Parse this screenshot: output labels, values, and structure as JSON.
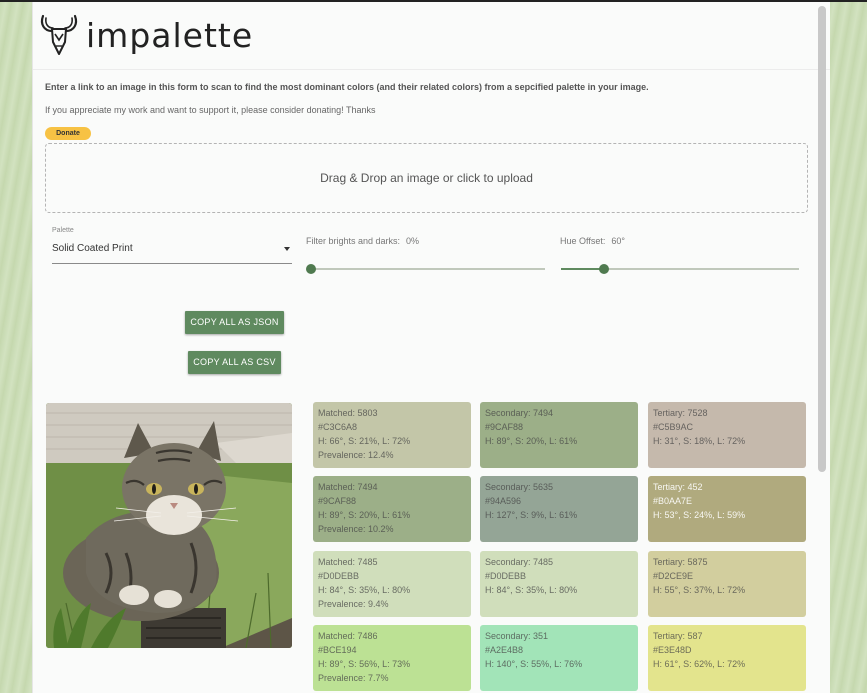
{
  "app": {
    "name": "impalette"
  },
  "intro": {
    "text": "Enter a link to an image in this form to scan to find the most dominant colors (and their related colors) from a sepcified palette in your image.",
    "support": "If you appreciate my work and want to support it, please consider donating! Thanks",
    "donate_label": "Donate"
  },
  "upload": {
    "label": "Drag & Drop an image or click to upload"
  },
  "palette": {
    "label": "Palette",
    "value": "Solid Coated Print"
  },
  "sliders": {
    "filter": {
      "label": "Filter brights and darks:",
      "value_text": "0%",
      "level": 0
    },
    "hue": {
      "label": "Hue Offset:",
      "value_text": "60°",
      "level": 0.18
    }
  },
  "buttons": {
    "copy_json": "COPY ALL AS JSON",
    "copy_csv": "COPY ALL AS CSV"
  },
  "image": {
    "subject": "tabby cat on grass"
  },
  "swatches": [
    {
      "lines": [
        "Matched: 5803",
        "#C3C6A8",
        "H: 66°, S: 21%, L: 72%",
        "Prevalence: 12.4%"
      ],
      "color": "#C3C6A8",
      "text_tone": "light"
    },
    {
      "lines": [
        "Secondary: 7494",
        "#9CAF88",
        "H: 89°, S: 20%, L: 61%"
      ],
      "color": "#9CAF88",
      "text_tone": "light"
    },
    {
      "lines": [
        "Tertiary: 7528",
        "#C5B9AC",
        "H: 31°, S: 18%, L: 72%"
      ],
      "color": "#C5B9AC",
      "text_tone": "light"
    },
    {
      "lines": [
        "Matched: 7494",
        "#9CAF88",
        "H: 89°, S: 20%, L: 61%",
        "Prevalence: 10.2%"
      ],
      "color": "#9CAF88",
      "text_tone": "light"
    },
    {
      "lines": [
        "Secondary: 5635",
        "#94A596",
        "H: 127°, S: 9%, L: 61%"
      ],
      "color": "#94A596",
      "text_tone": "light"
    },
    {
      "lines": [
        "Tertiary: 452",
        "#B0AA7E",
        "H: 53°, S: 24%, L: 59%"
      ],
      "color": "#B0AA7E",
      "text_tone": "dark"
    },
    {
      "lines": [
        "Matched: 7485",
        "#D0DEBB",
        "H: 84°, S: 35%, L: 80%",
        "Prevalence: 9.4%"
      ],
      "color": "#D0DEBB",
      "text_tone": "light"
    },
    {
      "lines": [
        "Secondary: 7485",
        "#D0DEBB",
        "H: 84°, S: 35%, L: 80%"
      ],
      "color": "#D0DEBB",
      "text_tone": "light"
    },
    {
      "lines": [
        "Tertiary: 5875",
        "#D2CE9E",
        "H: 55°, S: 37%, L: 72%"
      ],
      "color": "#D2CE9E",
      "text_tone": "light"
    },
    {
      "lines": [
        "Matched: 7486",
        "#BCE194",
        "H: 89°, S: 56%, L: 73%",
        "Prevalence: 7.7%"
      ],
      "color": "#BCE194",
      "text_tone": "light"
    },
    {
      "lines": [
        "Secondary: 351",
        "#A2E4B8",
        "H: 140°, S: 55%, L: 76%"
      ],
      "color": "#A2E4B8",
      "text_tone": "light"
    },
    {
      "lines": [
        "Tertiary: 587",
        "#E3E48D",
        "H: 61°, S: 62%, L: 72%"
      ],
      "color": "#E3E48D",
      "text_tone": "light"
    }
  ]
}
